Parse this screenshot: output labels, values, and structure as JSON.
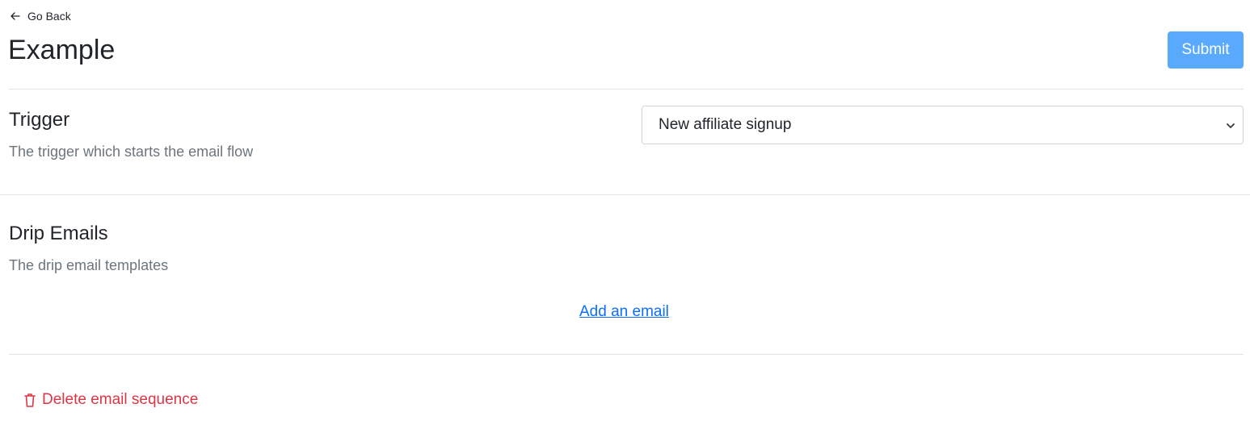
{
  "header": {
    "go_back_label": "Go Back",
    "title": "Example",
    "submit_label": "Submit"
  },
  "trigger": {
    "title": "Trigger",
    "description": "The trigger which starts the email flow",
    "selected_value": "New affiliate signup"
  },
  "drip": {
    "title": "Drip Emails",
    "description": "The drip email templates",
    "add_email_label": "Add an email"
  },
  "actions": {
    "delete_label": "Delete email sequence"
  },
  "colors": {
    "primary_button": "#59a9ff",
    "link": "#0d6efd",
    "danger": "#dc3545",
    "muted_text": "#6c757d",
    "divider": "#e3e3e3"
  },
  "icons": {
    "back": "arrow-left-icon",
    "select": "chevron-down-icon",
    "delete": "trash-icon"
  }
}
